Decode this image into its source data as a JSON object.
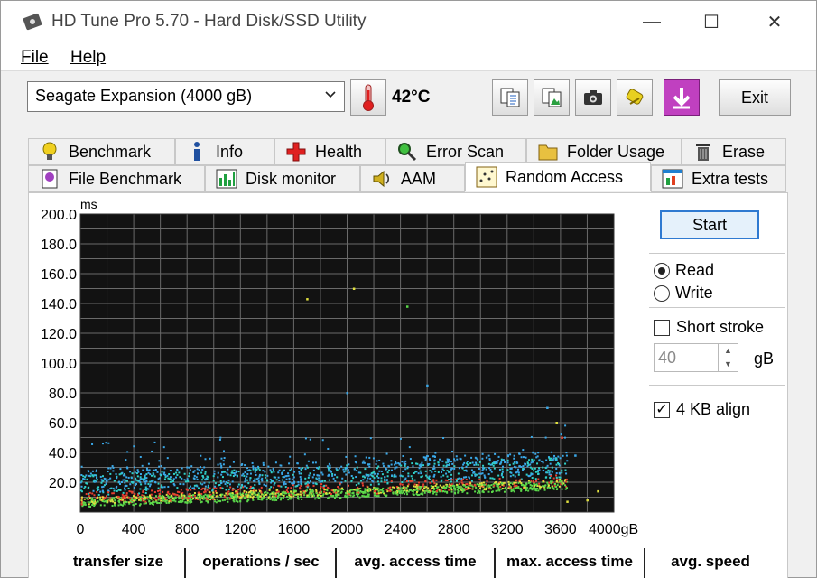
{
  "window": {
    "title": "HD Tune Pro 5.70 - Hard Disk/SSD Utility",
    "min_glyph": "—",
    "max_glyph": "☐",
    "close_glyph": "✕"
  },
  "menu": {
    "file": "File",
    "help": "Help"
  },
  "toolbar": {
    "drive": "Seagate Expansion (4000 gB)",
    "temperature": "42°C",
    "exit_label": "Exit",
    "icons": [
      "thermometer-icon",
      "copy-text-icon",
      "copy-image-icon",
      "camera-icon",
      "options-icon",
      "save-icon"
    ]
  },
  "tabs": {
    "row1": [
      "Benchmark",
      "Info",
      "Health",
      "Error Scan",
      "Folder Usage",
      "Erase"
    ],
    "row2": [
      "File Benchmark",
      "Disk monitor",
      "AAM",
      "Random Access",
      "Extra tests"
    ],
    "active": "Random Access"
  },
  "controls": {
    "start_label": "Start",
    "read_label": "Read",
    "write_label": "Write",
    "mode": "Read",
    "short_stroke_label": "Short stroke",
    "short_stroke_checked": false,
    "stroke_value": "40",
    "stroke_unit": "gB",
    "align_label": "4 KB align",
    "align_checked": true,
    "check_glyph": "✓"
  },
  "table": {
    "headers": [
      "transfer size",
      "operations / sec",
      "avg. access time",
      "max. access time",
      "avg. speed"
    ]
  },
  "chart_data": {
    "type": "scatter",
    "y_unit": "ms",
    "x_unit": "gB",
    "ylim": [
      0,
      200
    ],
    "xlim": [
      0,
      4000
    ],
    "y_ticks": [
      "200.0",
      "180.0",
      "160.0",
      "140.0",
      "120.0",
      "100.0",
      "80.0",
      "60.0",
      "40.0",
      "20.0"
    ],
    "x_ticks": [
      "0",
      "400",
      "800",
      "1200",
      "1600",
      "2000",
      "2400",
      "2800",
      "3200",
      "3600",
      "4000gB"
    ],
    "grid": true,
    "background": "#121212",
    "colors": [
      "#3aa8e8",
      "#2fd0c8",
      "#5ad84a",
      "#e0e040",
      "#e84030"
    ],
    "outliers": [
      {
        "x": 1700,
        "y": 143,
        "color": "#e0e040"
      },
      {
        "x": 2050,
        "y": 150,
        "color": "#e0e040"
      },
      {
        "x": 2450,
        "y": 138,
        "color": "#5ad84a"
      },
      {
        "x": 2600,
        "y": 85,
        "color": "#3aa8e8"
      },
      {
        "x": 2000,
        "y": 80,
        "color": "#3aa8e8"
      },
      {
        "x": 3500,
        "y": 70,
        "color": "#3aa8e8"
      },
      {
        "x": 3570,
        "y": 60,
        "color": "#e0e040"
      },
      {
        "x": 3650,
        "y": 7,
        "color": "#e0e040"
      },
      {
        "x": 3800,
        "y": 8,
        "color": "#e0e040"
      },
      {
        "x": 3880,
        "y": 14,
        "color": "#e0e040"
      },
      {
        "x": 3610,
        "y": 50,
        "color": "#e84030"
      },
      {
        "x": 3710,
        "y": 38,
        "color": "#3aa8e8"
      }
    ]
  }
}
